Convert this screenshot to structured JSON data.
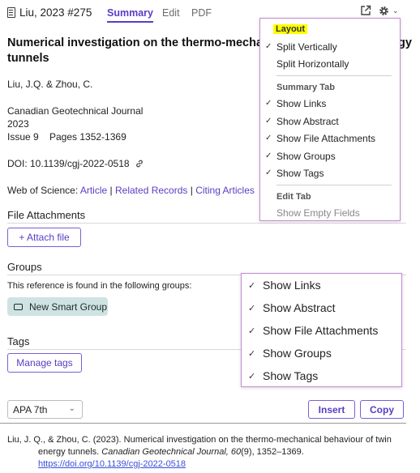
{
  "header": {
    "title": "Liu, 2023 #275",
    "tabs": [
      "Summary",
      "Edit",
      "PDF"
    ],
    "open_icon": "external-link-icon",
    "settings_icon": "gear-icon"
  },
  "record": {
    "title_line1": "Numerical investigation on the thermo-mechan",
    "title_line1_tail": "gy",
    "title_line2": "tunnels",
    "authors": "Liu, J.Q. & Zhou, C.",
    "journal": "Canadian Geotechnical Journal",
    "year": "2023",
    "issue": "Issue 9",
    "pages": "Pages 1352-1369",
    "doi": "DOI: 10.1139/cgj-2022-0518",
    "wos_label": "Web of Science:",
    "wos_links": [
      "Article",
      "Related Records",
      "Citing Articles"
    ],
    "wos_sep": "|"
  },
  "attachments": {
    "heading": "File Attachments",
    "button": "+ Attach file"
  },
  "groups": {
    "heading": "Groups",
    "description": "This reference is found in the following groups:",
    "chip": "New Smart Group"
  },
  "tags": {
    "heading": "Tags",
    "button": "Manage tags"
  },
  "footer": {
    "style": "APA 7th",
    "insert": "Insert",
    "copy": "Copy"
  },
  "citation": {
    "line1_a": "Liu, J. Q., & Zhou, C. (2023). Numerical investigation on the thermo-mechanical behaviour of twin",
    "line2_a": "energy tunnels. ",
    "line2_journal": "Canadian Geotechnical Journal, 60",
    "line2_b": "(9), 1352–1369.",
    "line3_url": "https://doi.org/10.1139/cgj-2022-0518"
  },
  "layout_menu": {
    "layout_heading": "Layout",
    "split_vertically": "Split Vertically",
    "split_horizontally": "Split Horizontally",
    "summary_heading": "Summary Tab",
    "show_links": "Show Links",
    "show_abstract": "Show Abstract",
    "show_file_attachments": "Show File Attachments",
    "show_groups": "Show Groups",
    "show_tags": "Show Tags",
    "edit_heading": "Edit Tab",
    "show_empty_fields": "Show Empty Fields",
    "check": "✓"
  },
  "zoom_menu": {
    "items": [
      "Show Links",
      "Show Abstract",
      "Show File Attachments",
      "Show Groups",
      "Show Tags"
    ],
    "check": "✓"
  },
  "colors": {
    "accent": "#5b3cc4",
    "menu_border": "#c58ad6",
    "highlight": "#ffff00",
    "chip_bg": "#cfe3e3"
  }
}
